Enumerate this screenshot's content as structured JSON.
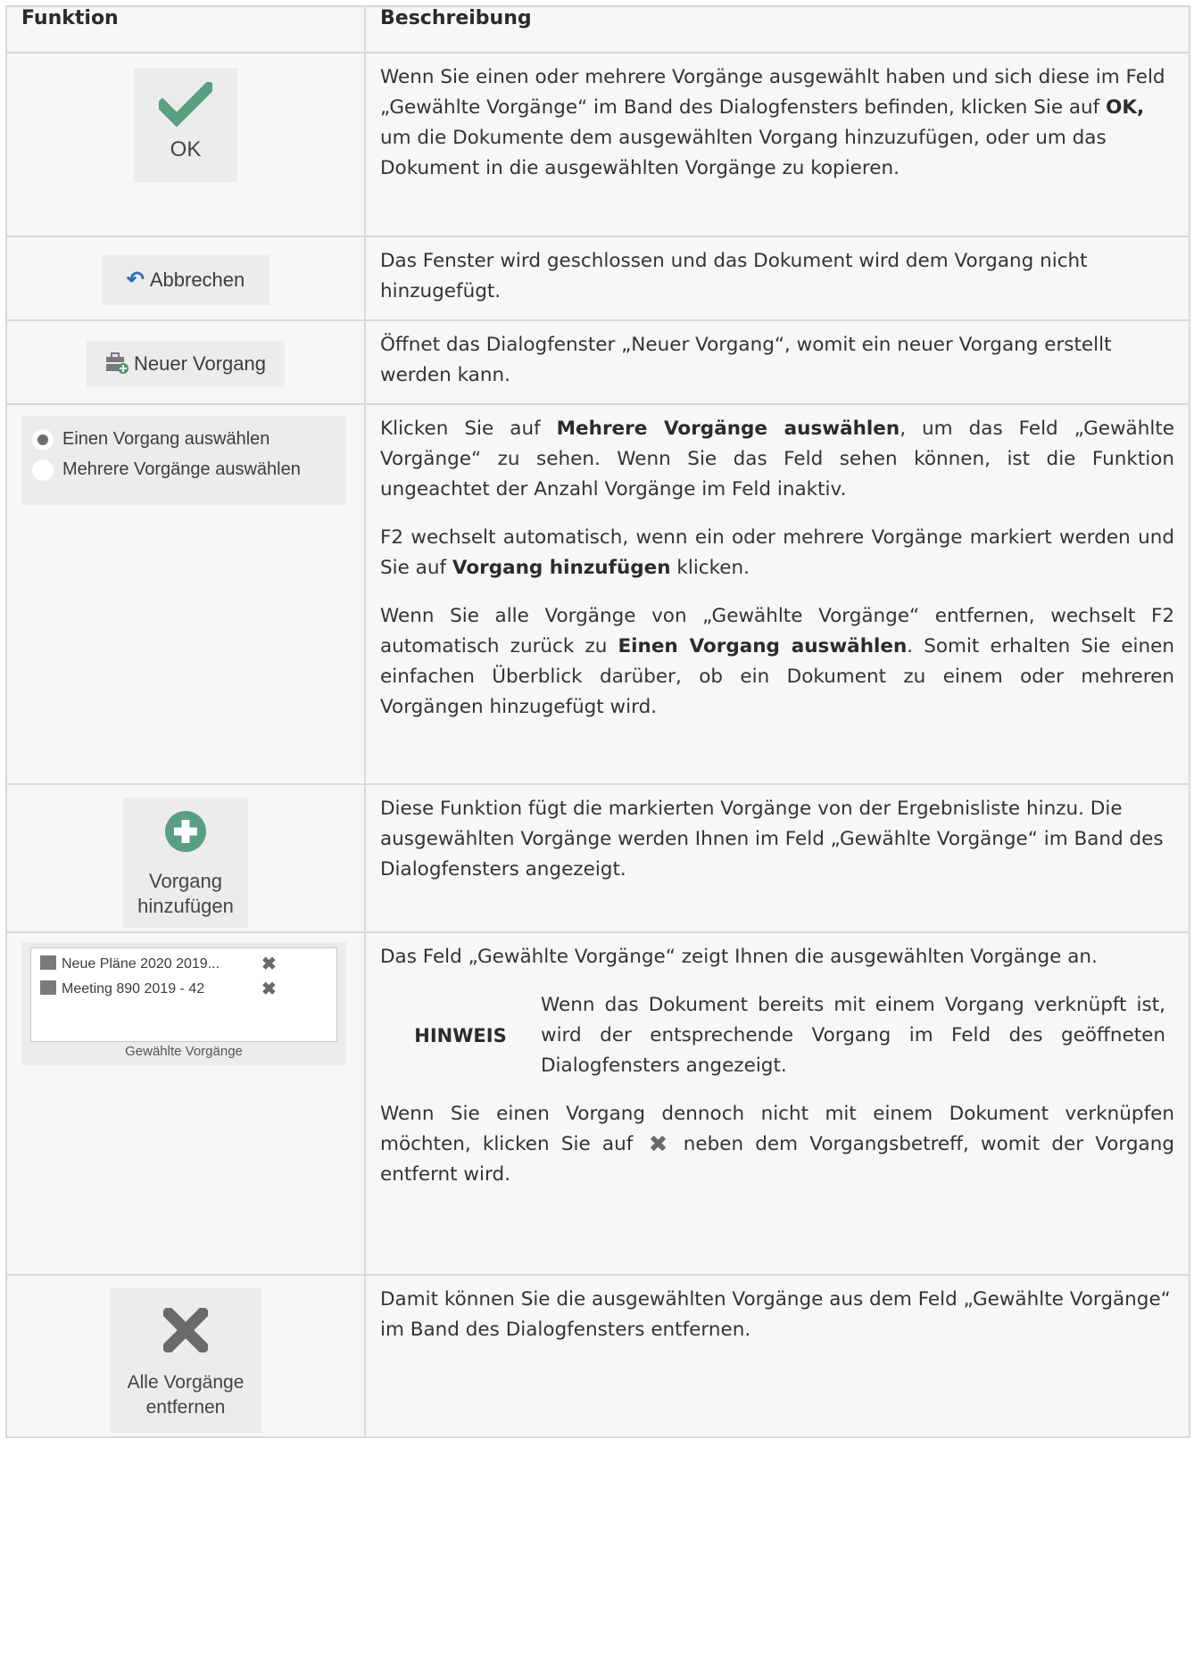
{
  "table": {
    "headers": {
      "function": "Funktion",
      "description": "Beschreibung"
    },
    "rows": [
      {
        "widget": {
          "label": "OK",
          "icon": "checkmark-icon",
          "color": "#5a9e84"
        },
        "desc_pre": "Wenn Sie einen oder mehrere Vorgänge ausgewählt haben und sich diese im Feld „Gewählte Vorgänge“ im Band des Dialogfensters befinden, klicken Sie auf ",
        "desc_bold": "OK,",
        "desc_post": " um die Dokumente dem ausgewählten Vorgang hinzuzufügen, oder um das Dokument in die ausgewählten Vorgänge zu kopieren."
      },
      {
        "widget": {
          "label": "Abbrechen",
          "icon": "undo-arrow-icon",
          "color": "#2f6db5"
        },
        "desc": "Das Fenster wird geschlossen und das Dokument wird dem Vorgang nicht hinzugefügt."
      },
      {
        "widget": {
          "label": "Neuer Vorgang",
          "icon": "new-case-icon"
        },
        "desc": "Öffnet das Dialogfenster „Neuer Vorgang“, womit ein neuer Vorgang erstellt werden kann."
      },
      {
        "widget": {
          "option1": "Einen Vorgang auswählen",
          "option2": "Mehrere Vorgänge auswählen",
          "selected": "Einen Vorgang auswählen"
        },
        "p1_pre": "Klicken Sie auf ",
        "p1_bold": "Mehrere Vorgänge auswählen",
        "p1_post": ", um das Feld „Gewählte Vorgänge“ zu sehen. Wenn Sie das Feld sehen können, ist die Funktion ungeachtet der Anzahl Vorgänge im Feld inaktiv.",
        "p2_pre": "F2 wechselt automatisch, wenn ein oder mehrere Vorgänge markiert werden und Sie auf ",
        "p2_bold": "Vorgang hinzufügen",
        "p2_post": " klicken.",
        "p3_pre": "Wenn Sie alle Vorgänge von „Gewählte Vorgänge“ entfernen, wechselt F2 automatisch zurück zu ",
        "p3_bold": "Einen Vorgang auswählen",
        "p3_post": ". Somit erhalten Sie einen einfachen Überblick darüber, ob ein Dokument zu einem oder mehreren Vorgängen hinzugefügt wird."
      },
      {
        "widget": {
          "label_line1": "Vorgang",
          "label_line2": "hinzufügen",
          "icon": "plus-circle-icon",
          "color": "#5a9e84"
        },
        "desc": "Diese Funktion fügt die markierten Vorgänge von der Ergebnisliste hinzu. Die ausgewählten Vorgänge werden Ihnen im Feld „Gewählte Vorgänge“ im Band des Dialogfensters angezeigt."
      },
      {
        "widget": {
          "items": [
            "Neue Pläne 2020 2019...",
            "Meeting 890 2019 - 42"
          ],
          "caption": "Gewählte Vorgänge"
        },
        "p1": "Das Feld „Gewählte Vorgänge“ zeigt Ihnen die ausgewählten Vorgänge an.",
        "note_label": "HINWEIS",
        "note_text": "Wenn das Dokument bereits mit einem Vorgang verknüpft ist, wird der entsprechende Vorgang im Feld des geöffneten Dialogfensters angezeigt.",
        "p2_pre": "Wenn Sie einen Vorgang dennoch nicht mit einem Dokument verknüpfen möchten, klicken Sie auf",
        "p2_post": "neben dem Vorgangsbetreff, womit der Vorgang entfernt wird."
      },
      {
        "widget": {
          "label_line1": "Alle Vorgänge",
          "label_line2": "entfernen",
          "icon": "remove-x-icon",
          "color": "#6a6a6a"
        },
        "desc": "Damit können Sie die ausgewählten Vorgänge aus dem Feld „Gewählte Vorgänge“ im Band des Dialogfensters entfernen."
      }
    ]
  }
}
